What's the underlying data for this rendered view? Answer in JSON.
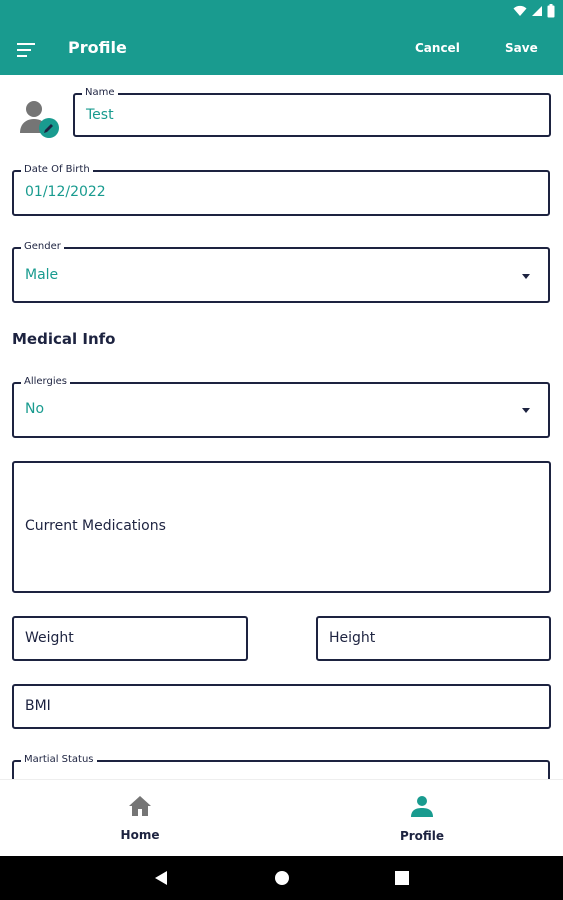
{
  "app_bar": {
    "title": "Profile",
    "cancel_label": "Cancel",
    "save_label": "Save",
    "color": "#199b8f"
  },
  "form": {
    "name": {
      "label": "Name",
      "value": "Test"
    },
    "dob": {
      "label": "Date Of Birth",
      "value": "01/12/2022"
    },
    "gender": {
      "label": "Gender",
      "value": "Male"
    },
    "medical_info_title": "Medical Info",
    "allergies": {
      "label": "Allergies",
      "value": "No"
    },
    "current_medications": {
      "placeholder": "Current Medications"
    },
    "weight": {
      "placeholder": "Weight"
    },
    "height": {
      "placeholder": "Height"
    },
    "bmi": {
      "placeholder": "BMI"
    },
    "marital_status": {
      "label": "Martial Status"
    }
  },
  "bottom_nav": {
    "items": [
      {
        "label": "Home",
        "icon": "home-icon",
        "active": false
      },
      {
        "label": "Profile",
        "icon": "person-icon",
        "active": true
      }
    ]
  },
  "colors": {
    "accent": "#199b8f",
    "text": "#1d2340",
    "icon_gray": "#757575"
  }
}
